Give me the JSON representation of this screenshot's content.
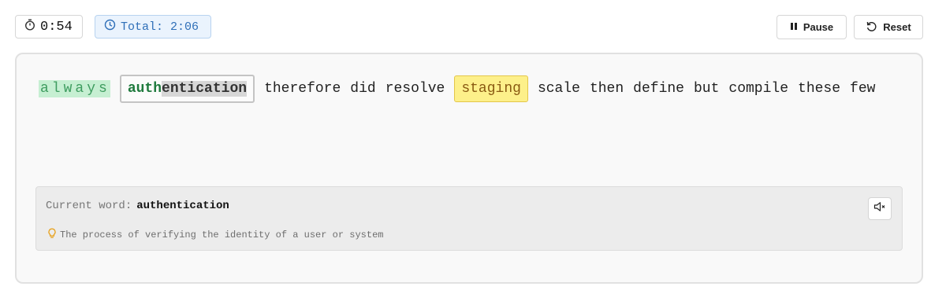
{
  "timer": {
    "current": "0:54",
    "total": "Total: 2:06"
  },
  "controls": {
    "pause_label": "Pause",
    "reset_label": "Reset"
  },
  "words": {
    "completed": "always",
    "current_typed": "auth",
    "current_rest": "entication",
    "upcoming_1": [
      "therefore",
      "did",
      "resolve"
    ],
    "highlighted": "staging",
    "upcoming_2": [
      "scale",
      "then",
      "define",
      "but",
      "compile",
      "these",
      "few"
    ]
  },
  "info": {
    "current_word_label": "Current word:",
    "current_word": "authentication",
    "definition": "The process of verifying the identity of a user or system"
  },
  "icons": {
    "timer": "stopwatch-icon",
    "total": "clock-icon",
    "pause": "pause-icon",
    "reset": "reset-icon",
    "hint": "lightbulb-icon",
    "audio": "speaker-muted-icon"
  },
  "colors": {
    "completed_bg": "#c6efd2",
    "completed_text": "#3e9c5f",
    "highlight_bg": "#fdf08a",
    "total_chip_bg": "#eaf3fd",
    "total_chip_text": "#2f6fb8"
  }
}
